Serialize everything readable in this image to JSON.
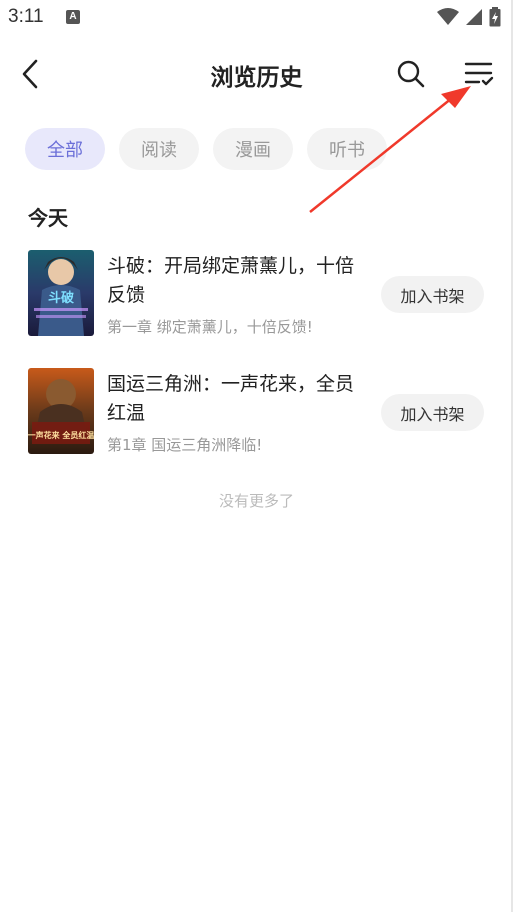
{
  "status_bar": {
    "time": "3:11",
    "app_icon_letter": "A",
    "icons": [
      "wifi-icon",
      "signal-icon",
      "battery-icon"
    ]
  },
  "header": {
    "title": "浏览历史",
    "back_icon": "chevron-left-icon",
    "search_icon": "search-icon",
    "manage_icon": "list-check-icon"
  },
  "tabs": [
    {
      "label": "全部",
      "active": true
    },
    {
      "label": "阅读",
      "active": false
    },
    {
      "label": "漫画",
      "active": false
    },
    {
      "label": "听书",
      "active": false
    }
  ],
  "section": {
    "title": "今天"
  },
  "books": [
    {
      "title": "斗破：开局绑定萧薰儿，十倍反馈",
      "chapter": "第一章 绑定萧薰儿，十倍反馈!",
      "button": "加入书架",
      "cover_text": "斗破"
    },
    {
      "title": "国运三角洲：一声花来，全员红温",
      "chapter": "第1章 国运三角洲降临!",
      "button": "加入书架",
      "cover_text": "一声花来 全员红温"
    }
  ],
  "footer": {
    "no_more": "没有更多了"
  },
  "colors": {
    "accent": "#6b6fd8",
    "active_tab_bg": "#e8e8fb",
    "annotation_arrow": "#f0392b"
  }
}
